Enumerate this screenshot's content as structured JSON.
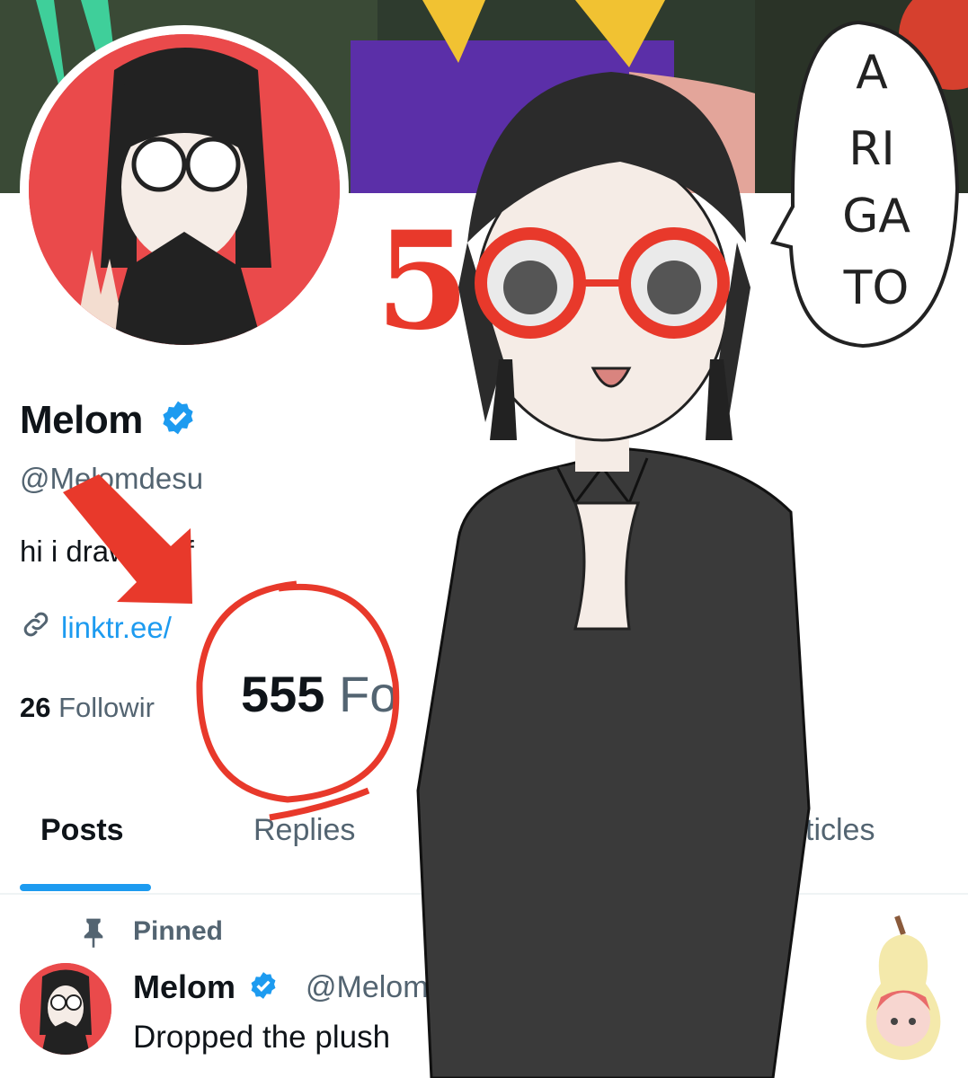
{
  "profile": {
    "display_name": "Melom",
    "handle": "@Melomdesu",
    "bio": "hi i draw stuff",
    "link": "linktr.ee/",
    "following_count": "26",
    "following_label": "Followir",
    "followers_count": "555",
    "followers_label": "Fo"
  },
  "tabs": [
    {
      "label": "Posts",
      "active": true
    },
    {
      "label": "Replies",
      "active": false
    },
    {
      "label": "Articles",
      "active": false
    }
  ],
  "pinned_post": {
    "pinned_label": "Pinned",
    "author_name": "Melom",
    "author_handle": "@Melomd",
    "text": "Dropped the plush"
  },
  "overlay": {
    "speech_lines": [
      "A",
      "RI",
      "GA",
      "TO"
    ],
    "glasses_number": "5"
  },
  "colors": {
    "accent": "#1d9bf0",
    "annotation_red": "#e8392b",
    "verified": "#1d9bf0"
  },
  "icons": {
    "verified": "verified-badge-icon",
    "link": "link-icon",
    "pin": "pin-icon"
  }
}
